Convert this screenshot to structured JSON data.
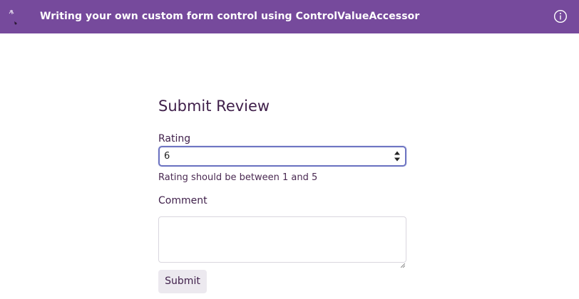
{
  "topbar": {
    "title": "Writing your own custom form control using ControlValueAccessor",
    "background": "#764a9c",
    "logo_icon": "sound-waves-logo-icon",
    "info_icon": "info-icon"
  },
  "form": {
    "title": "Submit Review",
    "rating": {
      "label": "Rating",
      "value": "6",
      "spinner_icon": "number-spinner-icon"
    },
    "error_message": "Rating should be between 1 and 5",
    "comment": {
      "label": "Comment",
      "value": ""
    },
    "submit_label": "Submit",
    "accent_color": "#6d74c2",
    "text_color": "#3f1f4a"
  }
}
